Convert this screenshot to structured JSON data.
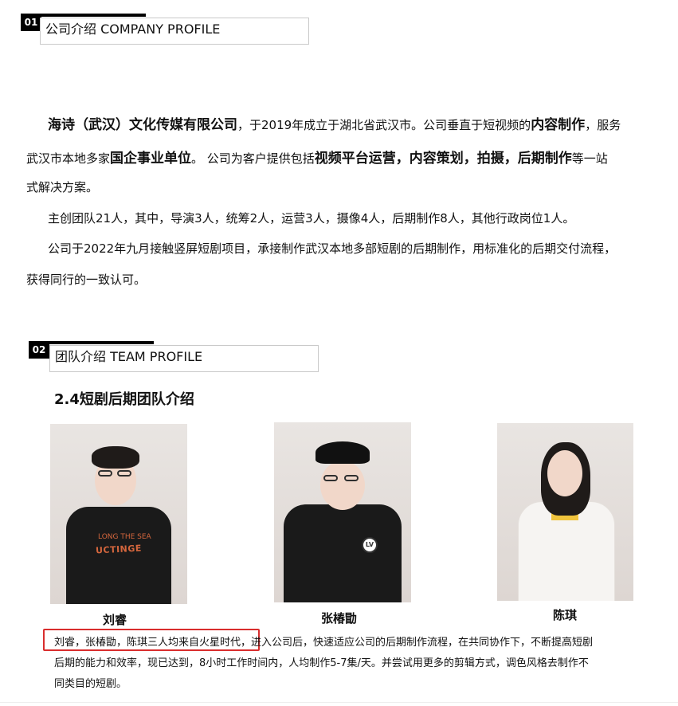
{
  "sections": {
    "company": {
      "number": "01",
      "title": "公司介绍 COMPANY PROFILE"
    },
    "team": {
      "number": "02",
      "title": "团队介绍 TEAM PROFILE"
    }
  },
  "company_profile": {
    "line1": {
      "part1": "海诗（武汉）文化传媒有限公司",
      "part2": "，于2019年成立于湖北省武汉市。公司垂直于短视频的",
      "part3": "内容制作",
      "part4": "，服务"
    },
    "line2": {
      "part1": "武汉市本地多家",
      "part2": "国企事业单位",
      "part3": "。  公司为客户提供包括",
      "part4": "视频平台运营，内容策划，拍摄，后期制作",
      "part5": "等一站"
    },
    "line3": "式解决方案。",
    "line4": "主创团队21人，其中，导演3人，统筹2人，运营3人，摄像4人，后期制作8人，其他行政岗位1人。",
    "line5": "公司于2022年九月接触竖屏短剧项目，承接制作武汉本地多部短剧的后期制作，用标准化的后期交付流程，",
    "line6": "获得同行的一致认可。"
  },
  "team_profile": {
    "subtitle": "2.4短剧后期团队介绍",
    "members": [
      {
        "name": "刘睿"
      },
      {
        "name": "张椿勖"
      },
      {
        "name": "陈琪"
      }
    ],
    "shirt_text_top": "LONG THE SEA",
    "shirt_text_main": "UCTINGE",
    "jacket_logo": "LV",
    "description": {
      "line1_highlight": "刘睿，张椿勖，陈琪三人均来自火星时代",
      "line1_rest": "，进入公司后，快速适应公司的后期制作流程，在共同协作下，不断提高短剧",
      "line2": "后期的能力和效率，现已达到，8小时工作时间内，人均制作5-7集/天。并尝试用更多的剪辑方式，调色风格去制作不",
      "line3": "同类目的短剧。"
    }
  }
}
